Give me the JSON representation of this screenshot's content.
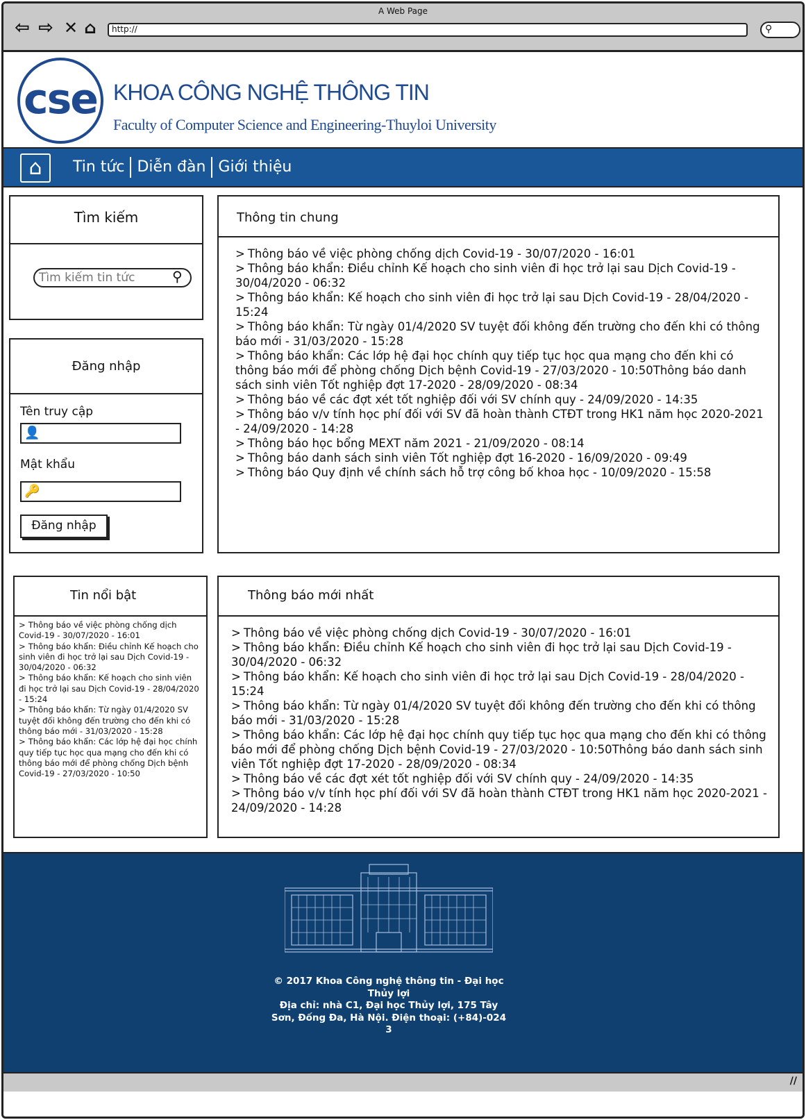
{
  "browser": {
    "title": "A Web Page",
    "address": "http://",
    "back_icon": "arrow-left-icon",
    "forward_icon": "arrow-right-icon",
    "close_icon": "close-icon",
    "home_icon": "home-icon"
  },
  "header": {
    "logo_text": "cse",
    "title": "KHOA CÔNG NGHỆ THÔNG TIN",
    "subtitle": "Faculty of Computer Science and Engineering-Thuyloi University"
  },
  "nav": {
    "home_icon": "home-icon",
    "links": [
      "Tin tức",
      "Diễn đàn",
      "Giới thiệu"
    ]
  },
  "search": {
    "title": "Tìm kiếm",
    "placeholder": "Tìm kiếm tin tức"
  },
  "login": {
    "title": "Đăng nhập",
    "username_label": "Tên truy cập",
    "password_label": "Mật khẩu",
    "button": "Đăng nhập"
  },
  "general": {
    "title": "Thông tin chung",
    "items": [
      "Thông báo về việc phòng chống dịch Covid-19 - 30/07/2020 - 16:01",
      "Thông báo khẩn: Điều chỉnh Kế hoạch cho sinh viên đi học trở lại sau Dịch Covid-19 - 30/04/2020 - 06:32",
      "Thông báo khẩn: Kế hoạch cho sinh viên đi học trở lại sau Dịch Covid-19 - 28/04/2020 - 15:24",
      "Thông báo khẩn: Từ ngày 01/4/2020 SV tuyệt đối không đến trường cho đến khi có thông báo mới - 31/03/2020 -    15:28",
      "Thông báo khẩn: Các lớp hệ đại học chính quy tiếp tục học qua mạng cho đến khi có thông báo mới để phòng chống Dịch bệnh Covid-19 - 27/03/2020 - 10:50Thông báo danh sách sinh viên Tốt nghiệp đợt 17-2020 - 28/09/2020 - 08:34",
      "Thông báo về các đợt xét tốt nghiệp đối với SV chính quy - 24/09/2020 - 14:35",
      "Thông báo v/v tính học phí đối với SV đã hoàn thành CTĐT trong HK1 năm học 2020-2021 - 24/09/2020 - 14:28",
      "Thông báo học bổng MEXT năm 2021 - 21/09/2020 - 08:14",
      "Thông báo danh sách sinh viên Tốt nghiệp đợt 16-2020 - 16/09/2020 - 09:49",
      "Thông báo Quy định về chính sách hỗ trợ công bố khoa học - 10/09/2020 - 15:58"
    ]
  },
  "featured": {
    "title": "Tin nổi bật",
    "items": [
      "Thông báo về việc phòng chống dịch Covid-19 - 30/07/2020 - 16:01",
      "Thông báo khẩn: Điều chỉnh Kế hoạch cho sinh viên đi học trở lại sau Dịch Covid-19 - 30/04/2020 - 06:32",
      "Thông báo khẩn: Kế hoạch cho sinh viên đi học trở lại sau Dịch Covid-19 - 28/04/2020 - 15:24",
      "Thông báo khẩn: Từ ngày 01/4/2020 SV tuyệt đối không đến trường cho đến khi có thông báo mới - 31/03/2020 -    15:28",
      "Thông báo khẩn: Các lớp hệ đại học chính quy tiếp tục học qua mạng cho đến khi có thông báo mới để phòng chống Dịch bệnh Covid-19 - 27/03/2020 - 10:50"
    ]
  },
  "latest": {
    "title": "Thông báo mới nhất",
    "items": [
      "Thông báo về việc phòng chống dịch Covid-19 - 30/07/2020 - 16:01",
      "Thông báo khẩn: Điều chỉnh Kế hoạch cho sinh viên đi học trở lại sau Dịch Covid-19 - 30/04/2020 - 06:32",
      "Thông báo khẩn: Kế hoạch cho sinh viên đi học trở lại sau Dịch Covid-19 - 28/04/2020 - 15:24",
      "Thông báo khẩn: Từ ngày 01/4/2020 SV tuyệt đối không đến trường cho đến khi có thông báo mới - 31/03/2020 -    15:28",
      "Thông báo khẩn: Các lớp hệ đại học chính quy tiếp tục học qua mạng cho đến khi có thông báo mới để phòng chống Dịch bệnh Covid-19 - 27/03/2020 - 10:50Thông báo danh sách sinh viên Tốt nghiệp đợt 17-2020 - 28/09/2020 - 08:34",
      "Thông báo về các đợt xét tốt nghiệp đối với SV chính quy - 24/09/2020 - 14:35",
      "Thông báo v/v tính học phí đối với SV đã hoàn thành CTĐT trong HK1 năm học 2020-2021 - 24/09/2020 - 14:28"
    ]
  },
  "footer": {
    "copyright": "© 2017 Khoa Công nghệ thông tin - Đại học Thủy lợi",
    "address": "Địa chỉ: nhà C1, Đại học Thủy lợi, 175 Tây Sơn, Đống Đa, Hà Nội. Điện thoại: (+84)-024 3",
    "image_icon": "building-image"
  },
  "colors": {
    "nav_bg": "#1a5799",
    "footer_bg": "#0f4070",
    "brand_blue": "#1f4a8f",
    "chrome_gray": "#c9c9c9"
  }
}
